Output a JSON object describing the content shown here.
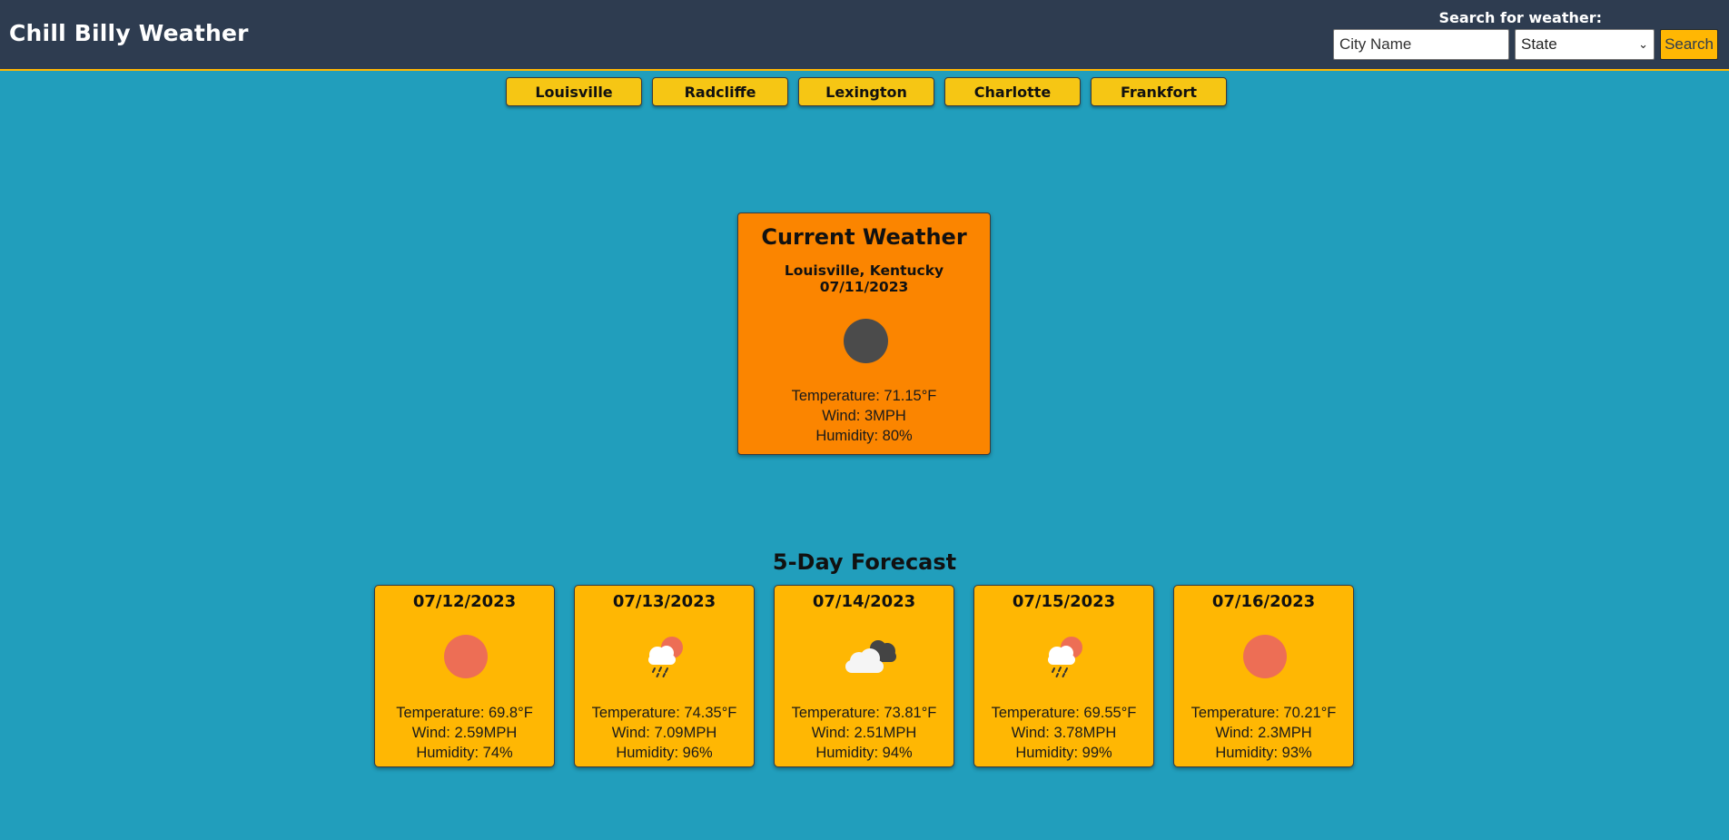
{
  "app": {
    "title": "Chill Billy Weather"
  },
  "search": {
    "label": "Search for weather:",
    "city_placeholder": "City Name",
    "state_selected": "State",
    "button_label": "Search"
  },
  "quick_cities": [
    "Louisville",
    "Radcliffe",
    "Lexington",
    "Charlotte",
    "Frankfort"
  ],
  "current": {
    "heading": "Current Weather",
    "location_date": "Louisville, Kentucky 07/11/2023",
    "icon": "dark-circle-icon",
    "temperature": "Temperature: 71.15°F",
    "wind": "Wind: 3MPH",
    "humidity": "Humidity: 80%"
  },
  "forecast": {
    "heading": "5-Day Forecast",
    "days": [
      {
        "date": "07/12/2023",
        "icon": "sun-icon",
        "temperature": "Temperature: 69.8°F",
        "wind": "Wind: 2.59MPH",
        "humidity": "Humidity: 74%"
      },
      {
        "date": "07/13/2023",
        "icon": "rain-sun-icon",
        "temperature": "Temperature: 74.35°F",
        "wind": "Wind: 7.09MPH",
        "humidity": "Humidity: 96%"
      },
      {
        "date": "07/14/2023",
        "icon": "clouds-icon",
        "temperature": "Temperature: 73.81°F",
        "wind": "Wind: 2.51MPH",
        "humidity": "Humidity: 94%"
      },
      {
        "date": "07/15/2023",
        "icon": "rain-sun-icon",
        "temperature": "Temperature: 69.55°F",
        "wind": "Wind: 3.78MPH",
        "humidity": "Humidity: 99%"
      },
      {
        "date": "07/16/2023",
        "icon": "sun-icon",
        "temperature": "Temperature: 70.21°F",
        "wind": "Wind: 2.3MPH",
        "humidity": "Humidity: 93%"
      }
    ]
  },
  "colors": {
    "background": "#219ebc",
    "header": "#2e3c50",
    "current_card": "#fb8500",
    "forecast_card": "#ffb703",
    "quick_button": "#f6c614"
  }
}
